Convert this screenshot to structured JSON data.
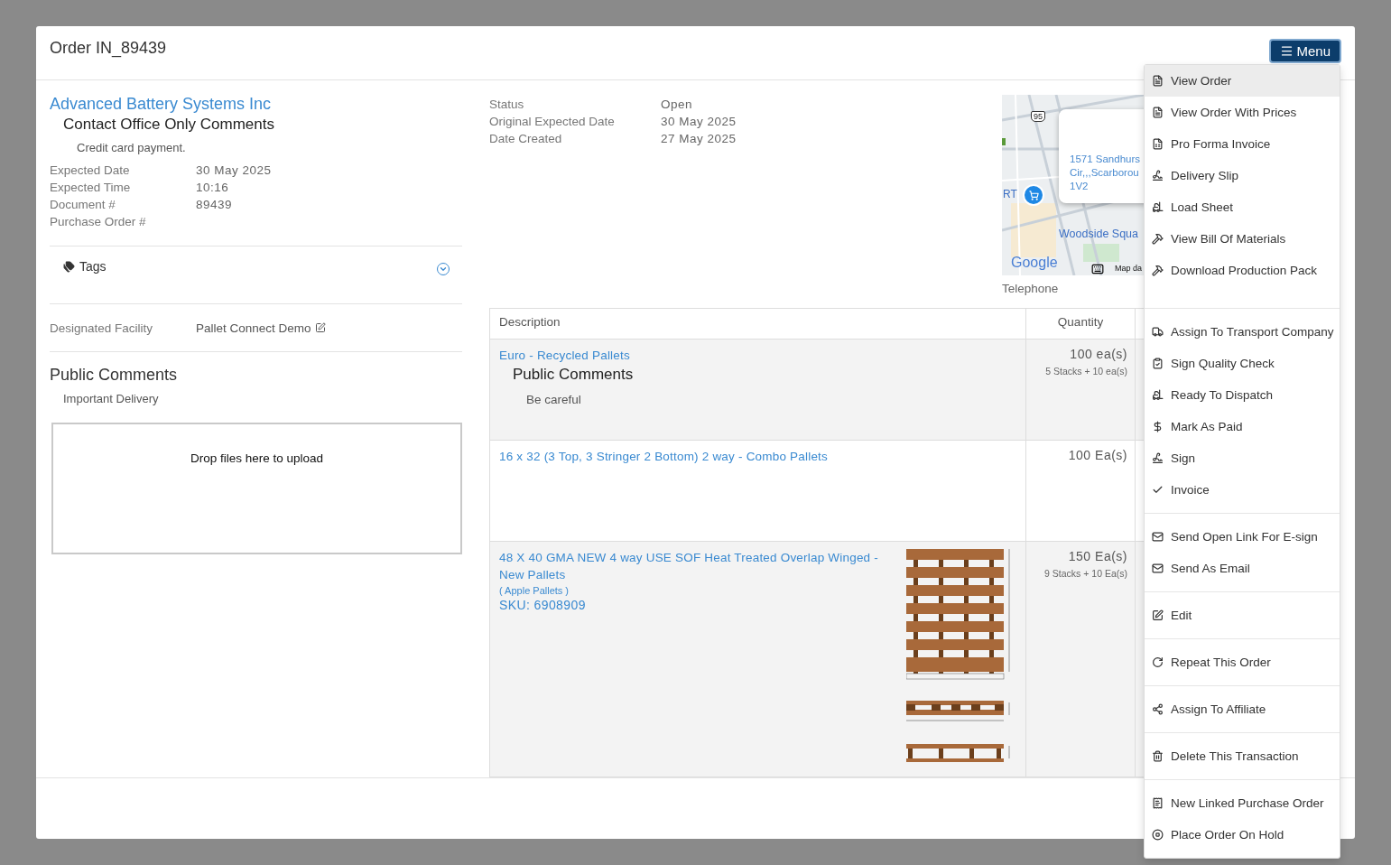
{
  "modal": {
    "title": "Order IN_89439",
    "menu_button": {
      "label": "Menu"
    }
  },
  "customer": {
    "name": "Advanced Battery Systems Inc",
    "comments_heading": "Contact Office Only Comments",
    "comment": "Credit card payment."
  },
  "details": [
    {
      "label": "Expected Date",
      "value": "30 May 2025"
    },
    {
      "label": "Expected Time",
      "value": "10:16"
    },
    {
      "label": "Document #",
      "value": "89439"
    },
    {
      "label": "Purchase Order #"
    }
  ],
  "tags": {
    "label": "Tags",
    "expanded": false
  },
  "facility": {
    "label": "Designated Facility",
    "value": "Pallet Connect Demo"
  },
  "public_comments": {
    "heading": "Public Comments",
    "text": "Important Delivery"
  },
  "dropzone": {
    "text": "Drop files here to upload"
  },
  "status_details": [
    {
      "label": "Status",
      "value": "Open"
    },
    {
      "label": "Original Expected Date",
      "value": "30 May 2025"
    },
    {
      "label": "Date Created",
      "value": "27 May 2025"
    }
  ],
  "map": {
    "route_shield": "95",
    "labels": [
      "RT",
      "Woodside Squa"
    ],
    "address_lines": [
      "1571 Sandhurs",
      "Cir,,,Scarborou",
      "1V2"
    ],
    "logo": "Google",
    "attribution": "Map da"
  },
  "telephone_label": "Telephone",
  "table": {
    "columns": [
      "Description",
      "Quantity"
    ],
    "rows": [
      {
        "kind": "plain",
        "description": "Euro - Recycled Pallets",
        "comments_heading": "Public Comments",
        "comment": "Be careful",
        "quantity": "100 ea(s)",
        "stacks": "5 Stacks + 10 ea(s)"
      },
      {
        "kind": "plain",
        "description": "16 x 32 (3 Top, 3 Stringer 2 Bottom) 2 way - Combo Pallets",
        "quantity": "100 Ea(s)"
      },
      {
        "kind": "with_drawing",
        "description": "48 X 40 GMA NEW 4 way USE SOF Heat Treated Overlap Winged - New Pallets",
        "category": "( Apple Pallets )",
        "sku": "SKU: 6908909",
        "quantity": "150 Ea(s)",
        "stacks": "9 Stacks + 10 Ea(s)"
      }
    ]
  },
  "menu": {
    "sections": [
      {
        "items": [
          {
            "label": "View Order",
            "selected": true
          },
          {
            "label": "View Order With Prices",
            "selected": false
          },
          {
            "label": "Pro Forma Invoice",
            "selected": false
          },
          {
            "label": "Delivery Slip",
            "selected": false
          },
          {
            "label": "Load Sheet",
            "selected": false
          },
          {
            "label": "View Bill Of Materials",
            "selected": false
          },
          {
            "label": "Download Production Pack",
            "selected": false
          }
        ]
      },
      {
        "items": [
          {
            "label": "Assign To Transport Company",
            "selected": false
          },
          {
            "label": "Sign Quality Check",
            "selected": false
          },
          {
            "label": "Ready To Dispatch",
            "selected": false
          },
          {
            "label": "Mark As Paid",
            "selected": false
          },
          {
            "label": "Sign",
            "selected": false
          },
          {
            "label": "Invoice",
            "selected": false
          }
        ]
      },
      {
        "items": [
          {
            "label": "Send Open Link For E-sign",
            "selected": false
          },
          {
            "label": "Send As Email",
            "selected": false
          }
        ]
      },
      {
        "items": [
          {
            "label": "Edit",
            "selected": false
          }
        ]
      },
      {
        "items": [
          {
            "label": "Repeat This Order",
            "selected": false
          }
        ]
      },
      {
        "items": [
          {
            "label": "Assign To Affiliate",
            "selected": false
          }
        ]
      },
      {
        "items": [
          {
            "label": "Delete This Transaction",
            "selected": false
          }
        ]
      },
      {
        "items": [
          {
            "label": "New Linked Purchase Order",
            "selected": false
          },
          {
            "label": "Place Order On Hold",
            "selected": false
          }
        ]
      }
    ]
  }
}
